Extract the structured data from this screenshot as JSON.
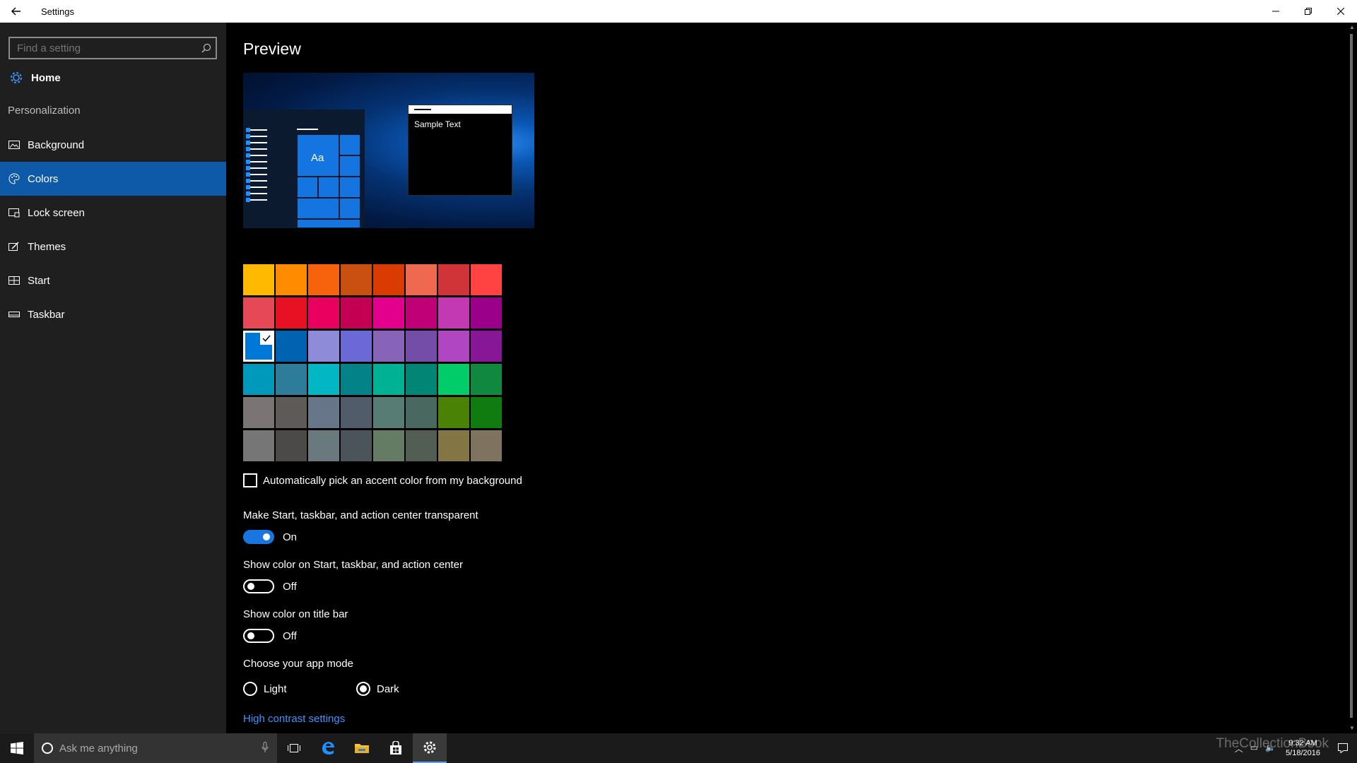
{
  "window": {
    "title": "Settings"
  },
  "sidebar": {
    "search_placeholder": "Find a setting",
    "home_label": "Home",
    "section_label": "Personalization",
    "items": [
      {
        "label": "Background",
        "icon": "picture-icon",
        "active": false
      },
      {
        "label": "Colors",
        "icon": "palette-icon",
        "active": true
      },
      {
        "label": "Lock screen",
        "icon": "lock-screen-icon",
        "active": false
      },
      {
        "label": "Themes",
        "icon": "themes-icon",
        "active": false
      },
      {
        "label": "Start",
        "icon": "start-icon",
        "active": false
      },
      {
        "label": "Taskbar",
        "icon": "taskbar-icon",
        "active": false
      }
    ]
  },
  "main": {
    "title": "Preview",
    "preview": {
      "tile_text": "Aa",
      "sample_text": "Sample Text"
    },
    "accent_colors": [
      "#ffb900",
      "#ff8c00",
      "#f7630c",
      "#ca5010",
      "#da3b01",
      "#ef6950",
      "#d13438",
      "#ff4343",
      "#e74856",
      "#e81123",
      "#ea005e",
      "#c30052",
      "#e3008c",
      "#bf0077",
      "#c239b3",
      "#9a0089",
      "#0078d7",
      "#0063b1",
      "#8e8cd8",
      "#6b69d6",
      "#8764b8",
      "#744da9",
      "#b146c2",
      "#881798",
      "#0099bc",
      "#2d7d9a",
      "#00b7c3",
      "#038387",
      "#00b294",
      "#018574",
      "#00cc6a",
      "#10893e",
      "#7a7574",
      "#5d5a58",
      "#68768a",
      "#515c6b",
      "#567c73",
      "#486860",
      "#498205",
      "#107c10",
      "#767676",
      "#4c4a48",
      "#69797e",
      "#4a5459",
      "#647c64",
      "#525e54",
      "#847545",
      "#7e735f"
    ],
    "selected_color_index": 16,
    "auto_pick": {
      "label": "Automatically pick an accent color from my background",
      "checked": false
    },
    "transparent": {
      "label": "Make Start, taskbar, and action center transparent",
      "state": "On",
      "on": true
    },
    "show_color_start": {
      "label": "Show color on Start, taskbar, and action center",
      "state": "Off",
      "on": false
    },
    "show_color_title": {
      "label": "Show color on title bar",
      "state": "Off",
      "on": false
    },
    "app_mode": {
      "label": "Choose your app mode",
      "options": [
        "Light",
        "Dark"
      ],
      "selected": "Dark"
    },
    "high_contrast_link": "High contrast settings"
  },
  "taskbar": {
    "search_placeholder": "Ask me anything",
    "time": "9:32 AM",
    "date": "5/18/2016",
    "watermark": "TheCollectionBook"
  },
  "colors": {
    "accent": "#0078d7",
    "selected_nav": "#0e5aa8",
    "link": "#3b95ff"
  }
}
